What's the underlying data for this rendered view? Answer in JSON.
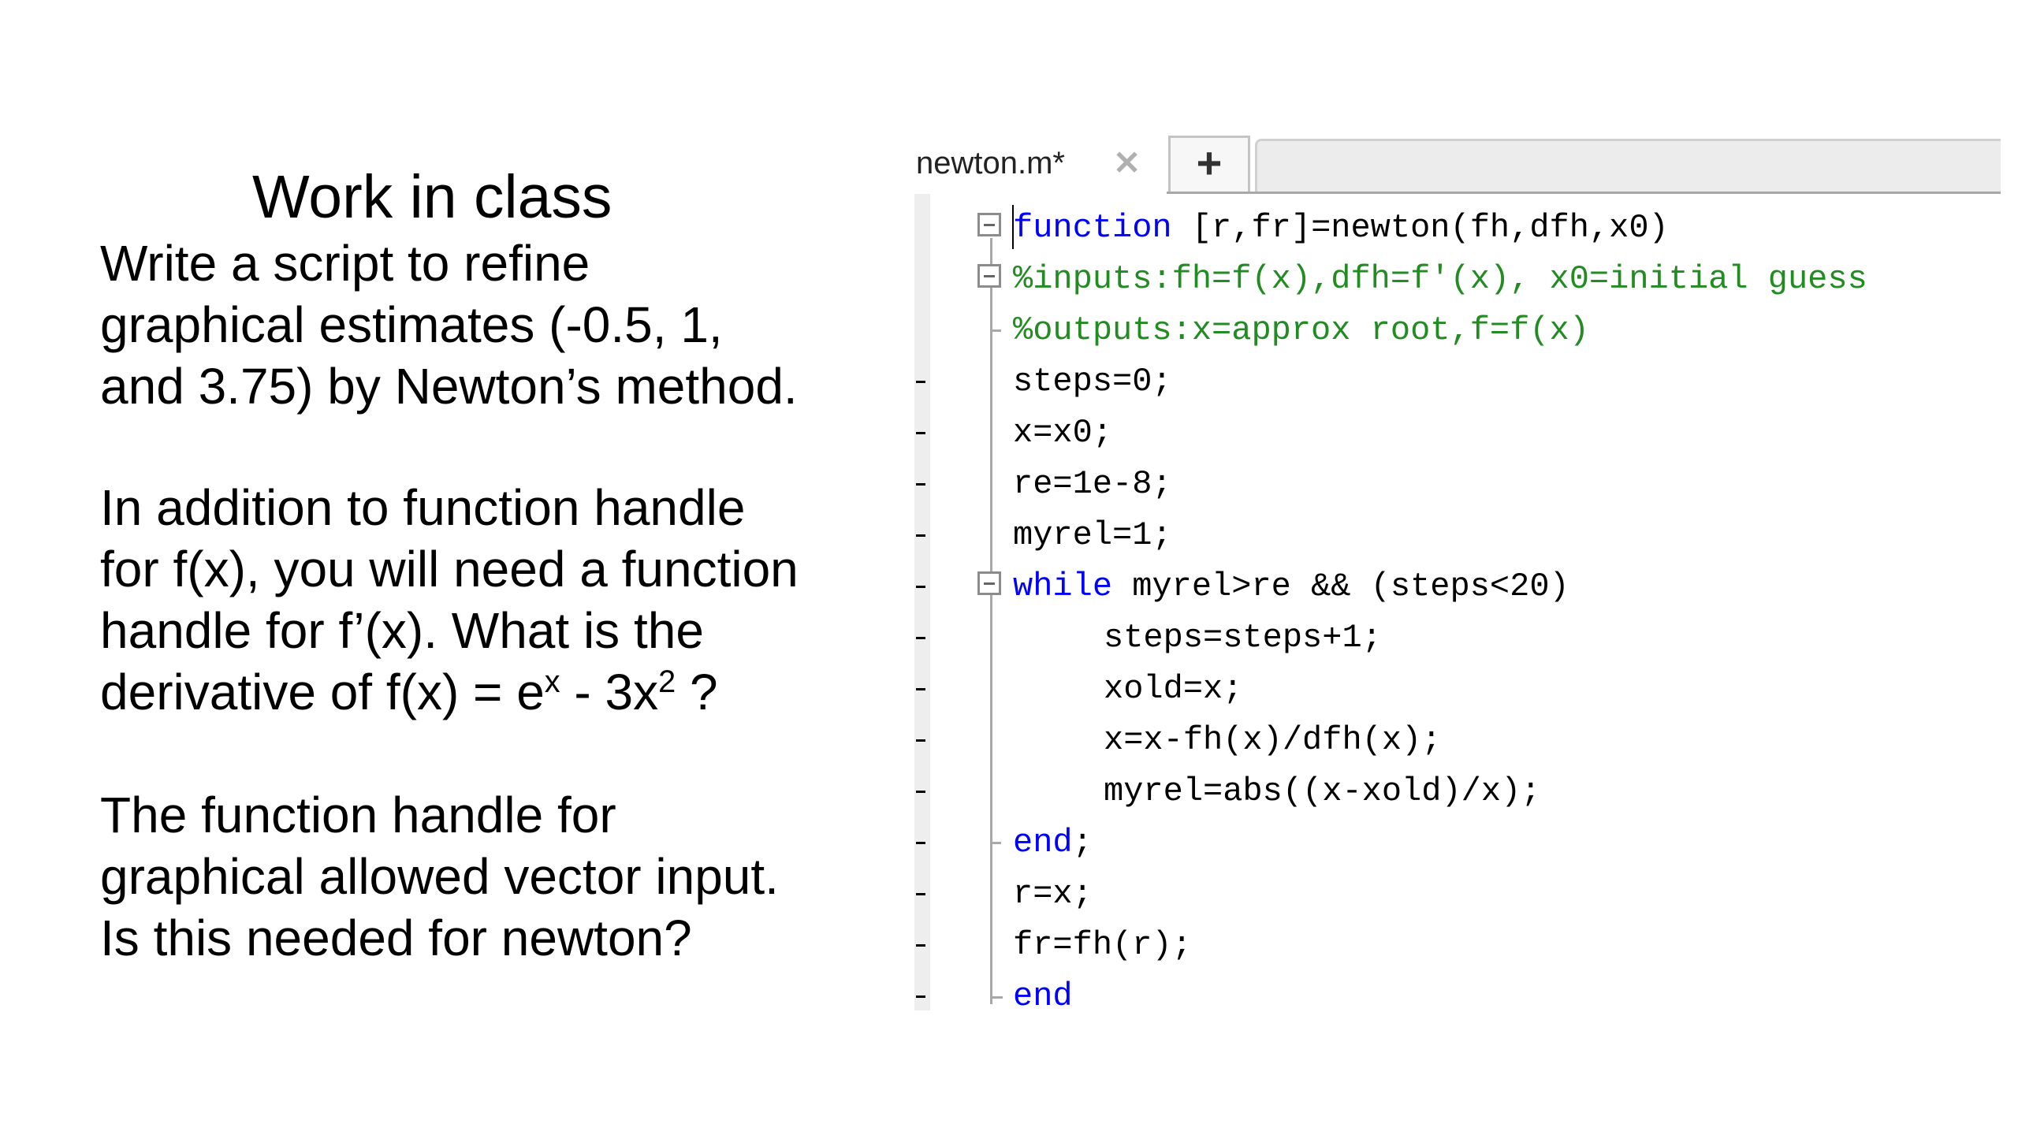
{
  "slide": {
    "title": "Work in class",
    "paragraph1": [
      "Write a script to refine",
      "graphical estimates (-0.5, 1,",
      "and 3.75) by Newton’s method."
    ],
    "paragraph2": {
      "lines": [
        "In addition to function handle",
        "for f(x), you will need a function",
        "handle for f’(x). What is the"
      ],
      "last_line_prefix": "derivative of f(x) = e",
      "superscript_1": "x",
      "last_line_middle": " - 3x",
      "superscript_2": "2",
      "last_line_suffix": " ?"
    },
    "paragraph3": [
      "The function handle for",
      "graphical allowed vector input.",
      "Is this needed for newton?"
    ]
  },
  "editor": {
    "tab_label": "newton.m*",
    "tab_close_icon": "close-icon",
    "new_tab_label": "+",
    "colors": {
      "keyword": "#0000ff",
      "comment": "#228b22",
      "text": "#000000"
    },
    "lines": [
      {
        "kw": "function",
        "text": " [r,fr]=newton(fh,dfh,x0)"
      },
      {
        "comment": "%inputs:fh=f(x),dfh=f'(x), x0=initial guess"
      },
      {
        "comment": "%outputs:x=approx root,f=f(x)"
      },
      {
        "text": "steps=0;"
      },
      {
        "text": "x=x0;"
      },
      {
        "text": "re=1e-8;"
      },
      {
        "text": "myrel=1;"
      },
      {
        "kw": "while",
        "text": " myrel>re && (steps<20)"
      },
      {
        "text": "steps=steps+1;"
      },
      {
        "text": "xold=x;"
      },
      {
        "text": "x=x-fh(x)/dfh(x);"
      },
      {
        "text": "myrel=abs((x-xold)/x);"
      },
      {
        "kw": "end",
        "text": ";"
      },
      {
        "text": "r=x;"
      },
      {
        "text": "fr=fh(r);"
      },
      {
        "kw": "end"
      }
    ]
  }
}
